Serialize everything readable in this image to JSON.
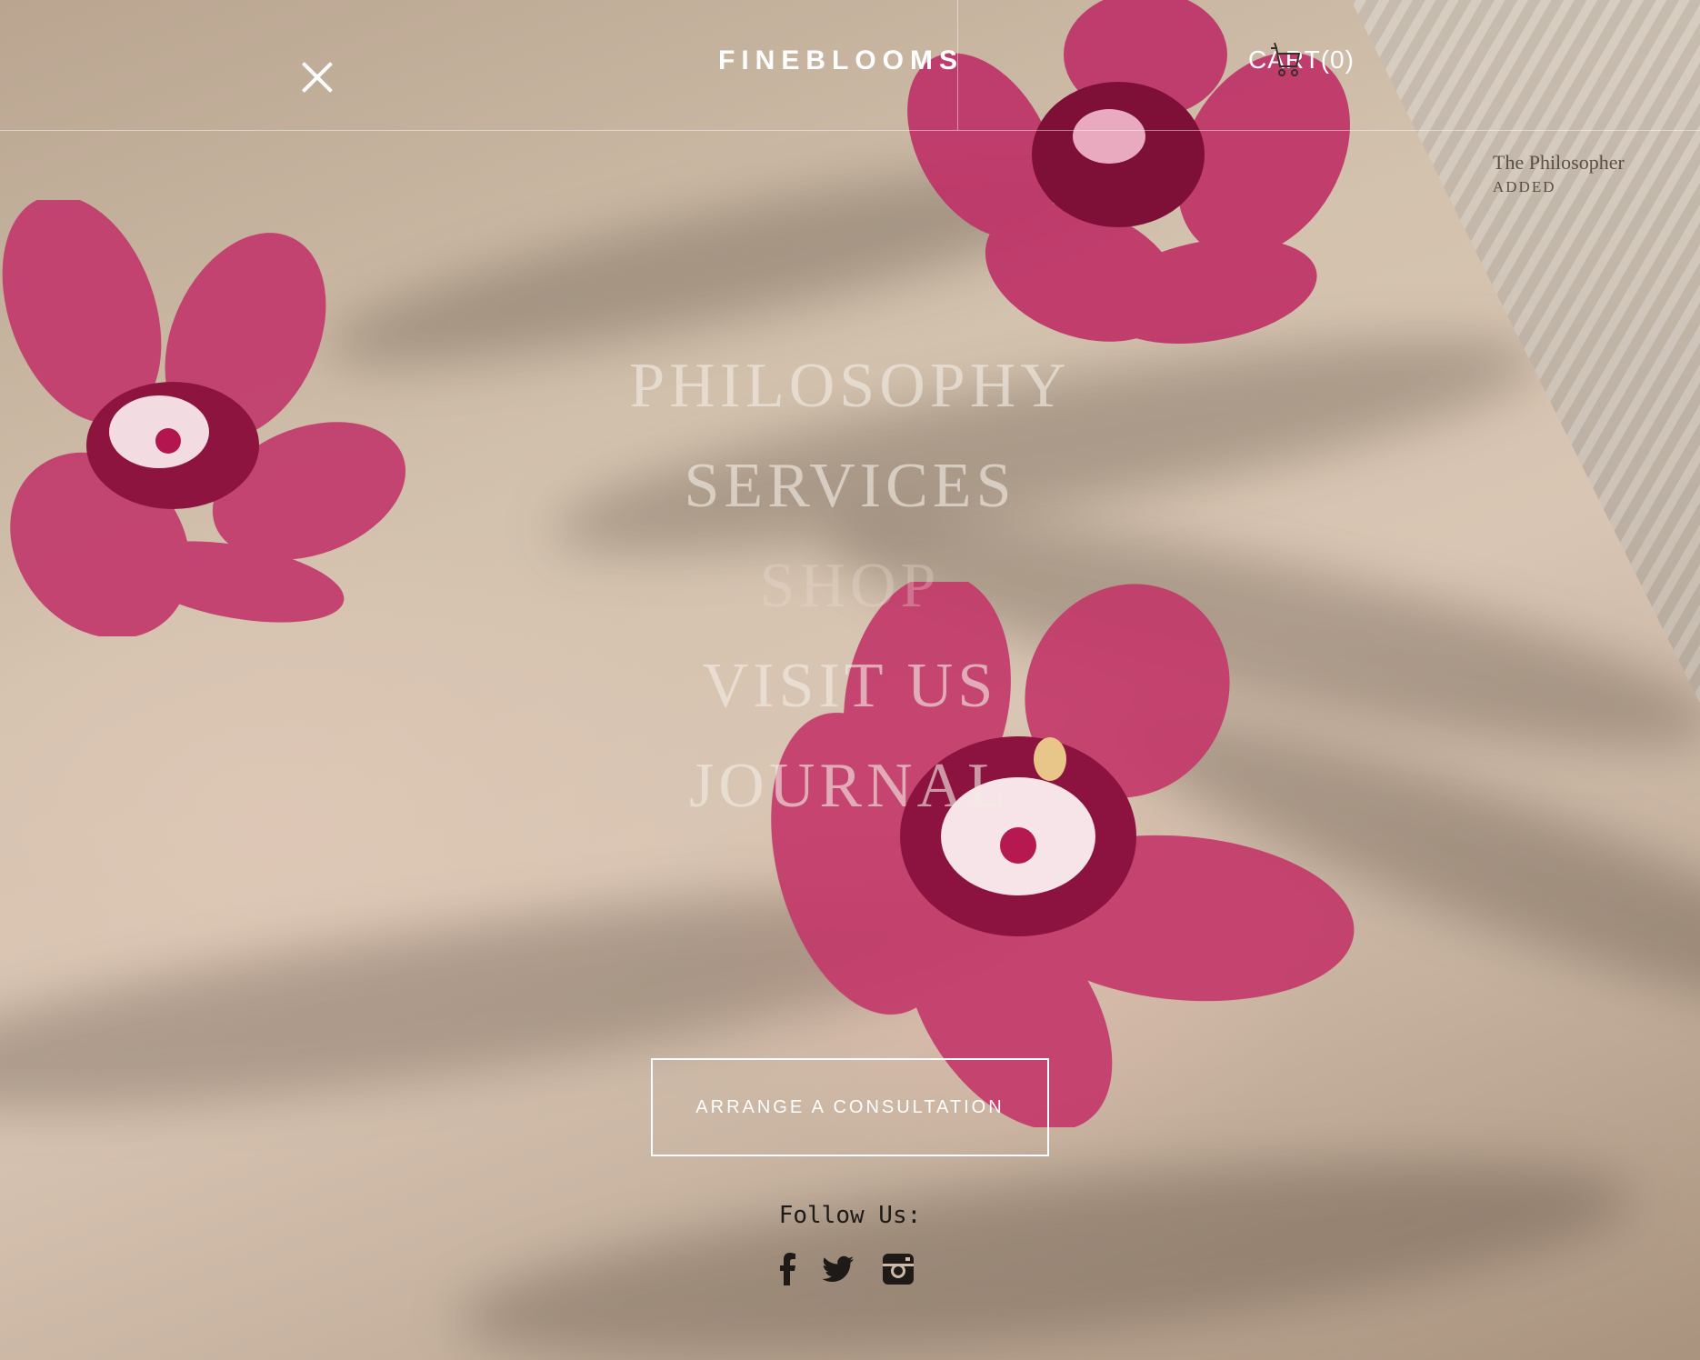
{
  "header": {
    "logo_text": "FINEBLOOMS",
    "cart_label": "CART",
    "cart_count": "(0)"
  },
  "cart_notice": {
    "item_name": "The Philosopher",
    "status": "ADDED"
  },
  "nav": {
    "items": [
      {
        "label": "PHILOSOPHY"
      },
      {
        "label": "SERVICES"
      },
      {
        "label": "SHOP"
      },
      {
        "label": "VISIT US"
      },
      {
        "label": "JOURNAL"
      }
    ]
  },
  "cta": {
    "label": "ARRANGE A CONSULTATION"
  },
  "social": {
    "heading": "Follow Us:",
    "icons": [
      "facebook-icon",
      "twitter-icon",
      "instagram-icon"
    ]
  },
  "colors": {
    "text_light": "#ffffff",
    "text_dark": "#1d1a18",
    "orchid": "#b8245a",
    "background": "#cdbba8"
  }
}
